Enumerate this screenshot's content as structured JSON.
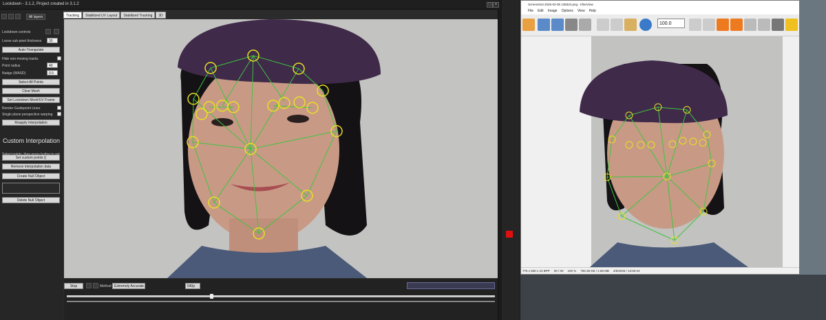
{
  "lockdown": {
    "window_title": "Lockdown - 3.1.2, Project created in 3.1.2",
    "layers_label": "All layers",
    "controls_label": "Lockdown controls",
    "subpixel_label": "Loose sub-pixel thickness",
    "subpixel_value": "30",
    "auto_triangulate": "Auto-Triangulate",
    "hide_nonmoving": "Hide non-moving tracks",
    "point_radius_label": "Point radius",
    "point_radius_value": "40",
    "nudge_label": "Nudge (WASD)",
    "nudge_value": "0.5",
    "select_all": "Select All Points",
    "clear_mesh": "Clear Mesh",
    "set_mesh": "Set Lockdown Mesh/UV Frame",
    "render_guidepoint": "Render Guidepoint Lines",
    "single_plane": "Single plane perspective warping",
    "reapply": "Reapply Interpolation",
    "custom_title": "Custom Interpolation",
    "custom_desc": "Select points, then press button to set interpolation per point",
    "set_custom": "Set custom points ()",
    "remove_interp": "Remove interpolation data",
    "create_null": "Create Null Object",
    "delete_null": "Delete Null Object",
    "tabs": [
      "Tracking",
      "Stabilized UV Layout",
      "Stabilized Tracking",
      "3D"
    ],
    "stop_label": "Stop",
    "method_label": "Method",
    "method_value": "Extremely Accurate",
    "frame_value": "540p"
  },
  "imageviewer": {
    "title": "Screenshot 2025-02-05 135024.png - IrfanView",
    "menu": [
      "File",
      "Edit",
      "Image",
      "Options",
      "View",
      "Help"
    ],
    "zoom_value": "100.0",
    "status": [
      "775 x 500 x 24 BPP",
      "00 / 00",
      "100 %",
      "760.36 KB / 2.58 MB",
      "2/5/2025 / 13:50:24"
    ]
  },
  "colors": {
    "accent_green": "#3ec43e",
    "marker_yellow": "#e8e020",
    "hat_purple": "#3f2a4a"
  }
}
